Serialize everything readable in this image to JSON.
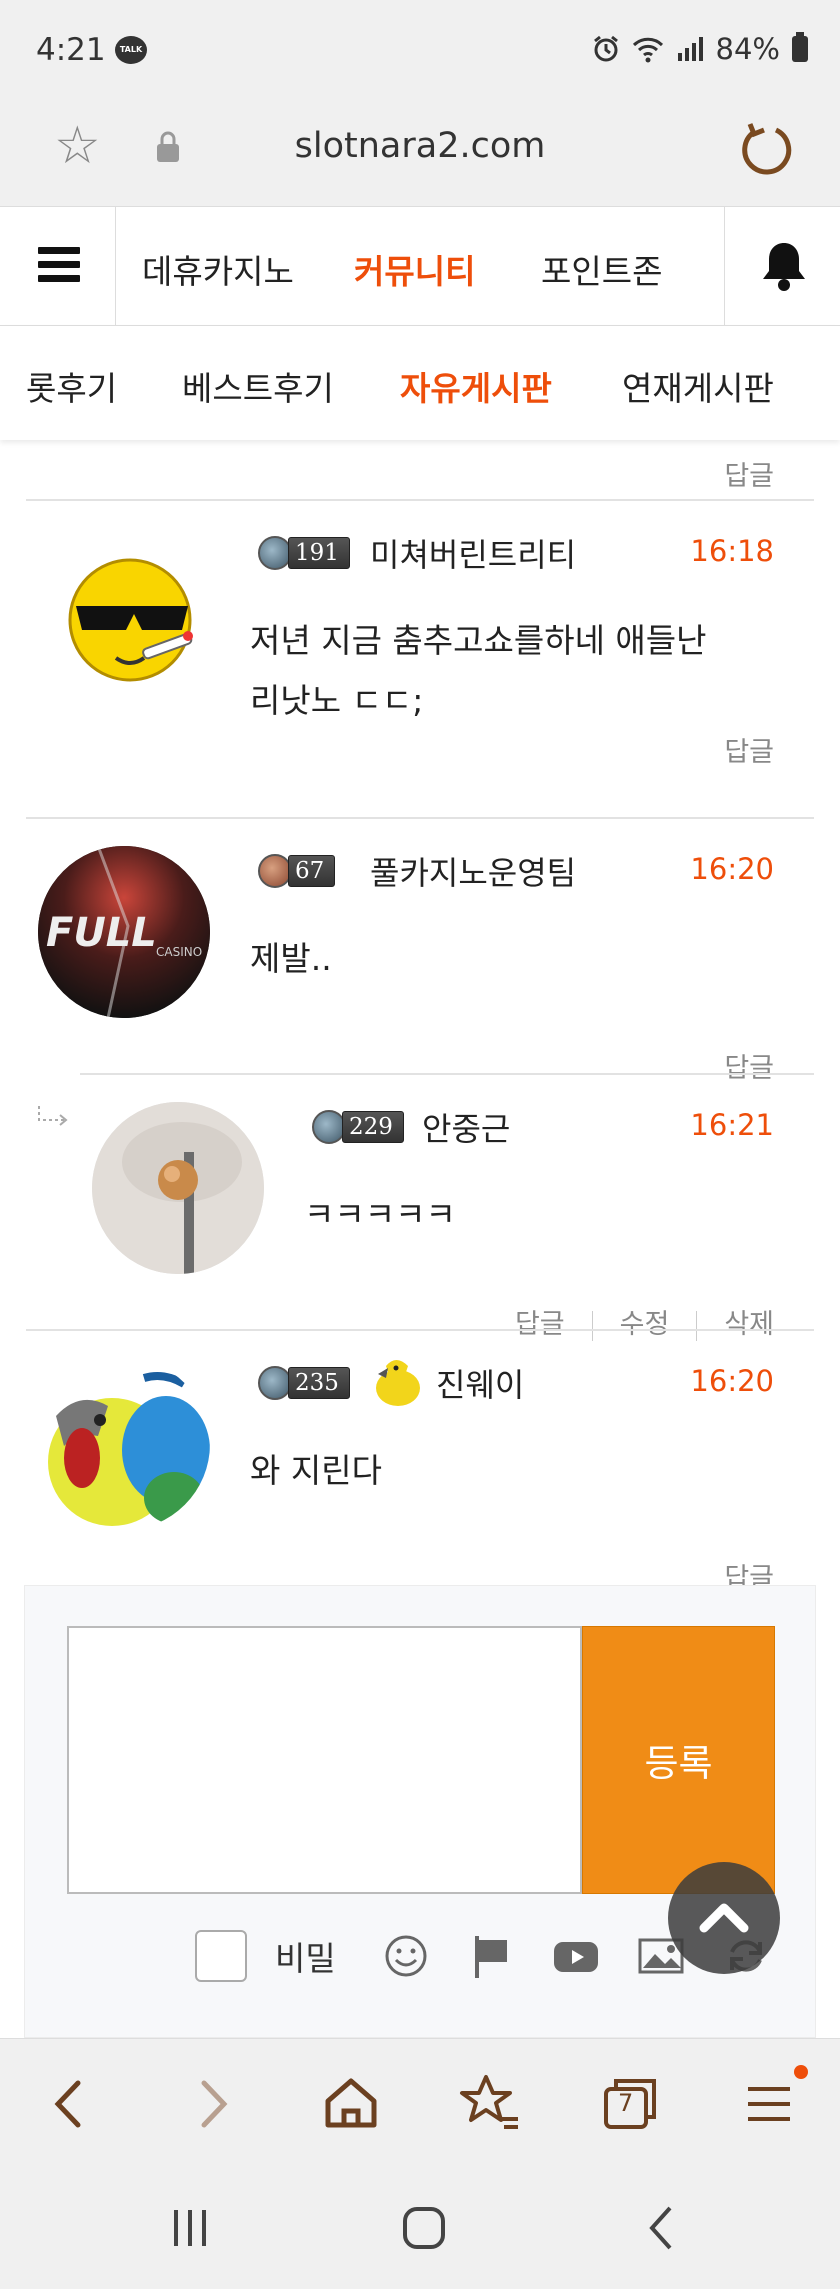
{
  "status_bar": {
    "time": "4:21",
    "talk_badge": "TALK",
    "battery": "84%"
  },
  "browser": {
    "url": "slotnara2.com",
    "tab_count": "7"
  },
  "nav_primary": {
    "items": [
      {
        "label": "데휴카지노",
        "active": false
      },
      {
        "label": "커뮤니티",
        "active": true
      },
      {
        "label": "포인트존",
        "active": false
      }
    ]
  },
  "nav_secondary": {
    "items": [
      {
        "label": "롯후기",
        "active": false
      },
      {
        "label": "베스트후기",
        "active": false
      },
      {
        "label": "자유게시판",
        "active": true
      },
      {
        "label": "연재게시판",
        "active": false
      }
    ]
  },
  "labels": {
    "reply": "답글",
    "edit": "수정",
    "delete": "삭제"
  },
  "comments": [
    {
      "level": "191",
      "name": "미쳐버린트리티",
      "time": "16:18",
      "text_line1": "저년 지금 춤추고쇼를하네 애들난",
      "text_line2": "리낫노 ㄷㄷ;"
    },
    {
      "level": "67",
      "name": "풀카지노운영팀",
      "time": "16:20",
      "text_line1": "제발.."
    },
    {
      "level": "229",
      "name": "안중근",
      "time": "16:21",
      "text_line1": "ㅋㅋㅋㅋㅋ",
      "is_reply": true
    },
    {
      "level": "235",
      "name": "진웨이",
      "time": "16:20",
      "text_line1": "와 지린다"
    }
  ],
  "avatar_text": {
    "full": "FULL",
    "casino": "CASINO"
  },
  "comment_form": {
    "submit_label": "등록",
    "secret_label": "비밀"
  },
  "colors": {
    "accent": "#ee4e0a",
    "submit_bg": "#f08c16"
  }
}
